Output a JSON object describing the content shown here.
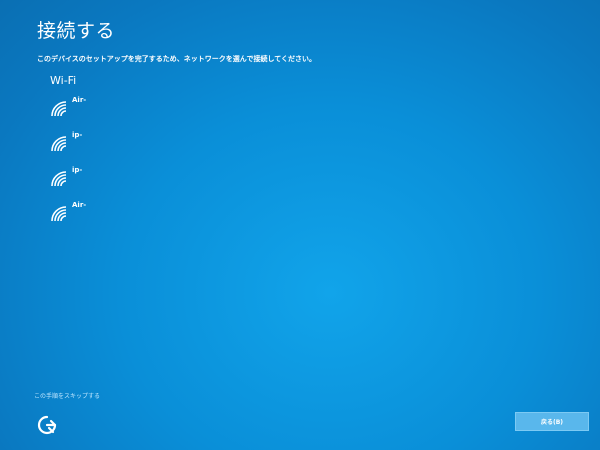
{
  "header": {
    "title": "接続する",
    "subtitle": "このデバイスのセットアップを完了するため、ネットワークを選んで接続してください。"
  },
  "wifi_section": {
    "title": "Wi-Fi",
    "networks": [
      {
        "name": "Air-",
        "icon": "wifi-signal-icon"
      },
      {
        "name": "ip-",
        "icon": "wifi-signal-icon"
      },
      {
        "name": "ip-",
        "icon": "wifi-signal-icon"
      },
      {
        "name": "Air-",
        "icon": "wifi-signal-icon"
      }
    ]
  },
  "footer": {
    "skip_label": "この手順をスキップする",
    "back_label": "戻る(B)",
    "ease_icon": "ease-of-access-icon"
  },
  "colors": {
    "background": "#0a8fd8",
    "button": "#59b7ec",
    "text": "#ffffff"
  }
}
